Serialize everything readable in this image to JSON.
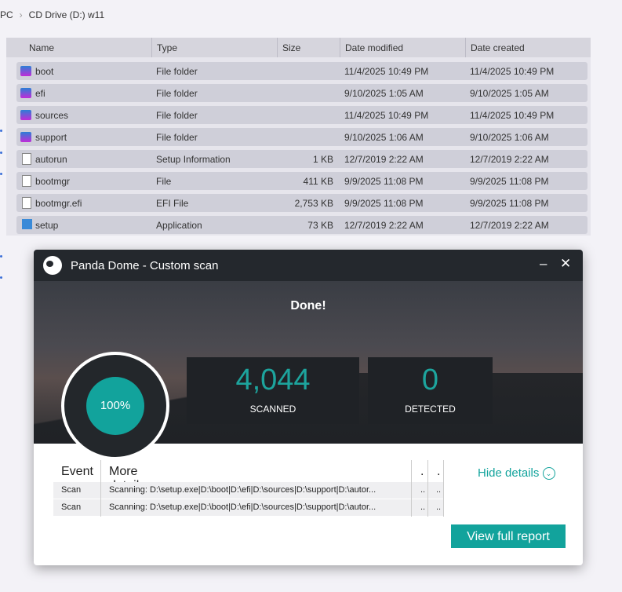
{
  "breadcrumb": [
    "PC",
    "CD Drive (D:) w11"
  ],
  "columns": [
    "Name",
    "Type",
    "Size",
    "Date modified",
    "Date created"
  ],
  "files": [
    {
      "name": "boot",
      "type": "File folder",
      "size": "",
      "modified": "11/4/2025 10:49 PM",
      "created": "11/4/2025 10:49 PM",
      "icon": "folder"
    },
    {
      "name": "efi",
      "type": "File folder",
      "size": "",
      "modified": "9/10/2025 1:05 AM",
      "created": "9/10/2025 1:05 AM",
      "icon": "folder"
    },
    {
      "name": "sources",
      "type": "File folder",
      "size": "",
      "modified": "11/4/2025 10:49 PM",
      "created": "11/4/2025 10:49 PM",
      "icon": "folder"
    },
    {
      "name": "support",
      "type": "File folder",
      "size": "",
      "modified": "9/10/2025 1:06 AM",
      "created": "9/10/2025 1:06 AM",
      "icon": "folder"
    },
    {
      "name": "autorun",
      "type": "Setup Information",
      "size": "1 KB",
      "modified": "12/7/2019 2:22 AM",
      "created": "12/7/2019 2:22 AM",
      "icon": "file"
    },
    {
      "name": "bootmgr",
      "type": "File",
      "size": "411 KB",
      "modified": "9/9/2025 11:08 PM",
      "created": "9/9/2025 11:08 PM",
      "icon": "file"
    },
    {
      "name": "bootmgr.efi",
      "type": "EFI File",
      "size": "2,753 KB",
      "modified": "9/9/2025 11:08 PM",
      "created": "9/9/2025 11:08 PM",
      "icon": "file"
    },
    {
      "name": "setup",
      "type": "Application",
      "size": "73 KB",
      "modified": "12/7/2019 2:22 AM",
      "created": "12/7/2019 2:22 AM",
      "icon": "app"
    }
  ],
  "dialog": {
    "title": "Panda Dome - Custom scan",
    "status": "Done!",
    "progress_label": "100%",
    "progress": 100,
    "scanned": "4,044",
    "scanned_label": "SCANNED",
    "detected": "0",
    "detected_label": "DETECTED",
    "table_headers": [
      "Event",
      "More details",
      ".",
      "."
    ],
    "rows": [
      {
        "event": "Scan",
        "details": "Scanning: D:\\setup.exe|D:\\boot|D:\\efi|D:\\sources|D:\\support|D:\\autor...",
        "c3": "..",
        "c4": ".."
      },
      {
        "event": "Scan",
        "details": "Scanning: D:\\setup.exe|D:\\boot|D:\\efi|D:\\sources|D:\\support|D:\\autor...",
        "c3": "..",
        "c4": ".."
      }
    ],
    "hide_details": "Hide details",
    "view_report": "View full report",
    "accent": "#12a39c"
  }
}
